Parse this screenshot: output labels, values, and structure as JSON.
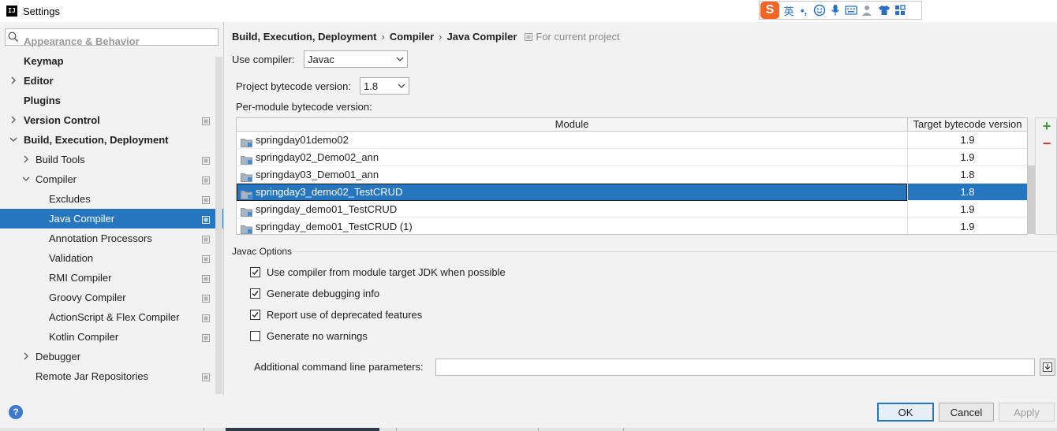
{
  "window": {
    "title": "Settings",
    "app_icon_text": "IJ"
  },
  "ime": {
    "logo": "S",
    "lang": "英",
    "punct": "•,",
    "icons": [
      "smiley-icon",
      "mic-icon",
      "keyboard-icon",
      "user-icon",
      "shirt-icon",
      "grid-icon"
    ]
  },
  "sidebar": {
    "search_placeholder": "",
    "items": [
      {
        "label": "Appearance & Behavior",
        "level": 0,
        "bold": true,
        "arrow": "",
        "faded": true,
        "copy": false
      },
      {
        "label": "Keymap",
        "level": 0,
        "bold": true,
        "arrow": "",
        "copy": false
      },
      {
        "label": "Editor",
        "level": 0,
        "bold": true,
        "arrow": "right",
        "copy": false
      },
      {
        "label": "Plugins",
        "level": 0,
        "bold": true,
        "arrow": "",
        "copy": false
      },
      {
        "label": "Version Control",
        "level": 0,
        "bold": true,
        "arrow": "right",
        "copy": true
      },
      {
        "label": "Build, Execution, Deployment",
        "level": 0,
        "bold": true,
        "arrow": "down",
        "copy": false
      },
      {
        "label": "Build Tools",
        "level": 1,
        "bold": false,
        "arrow": "right",
        "copy": true
      },
      {
        "label": "Compiler",
        "level": 1,
        "bold": false,
        "arrow": "down",
        "copy": true
      },
      {
        "label": "Excludes",
        "level": 2,
        "bold": false,
        "arrow": "",
        "copy": true
      },
      {
        "label": "Java Compiler",
        "level": 2,
        "bold": false,
        "arrow": "",
        "copy": true,
        "selected": true
      },
      {
        "label": "Annotation Processors",
        "level": 2,
        "bold": false,
        "arrow": "",
        "copy": true
      },
      {
        "label": "Validation",
        "level": 2,
        "bold": false,
        "arrow": "",
        "copy": true
      },
      {
        "label": "RMI Compiler",
        "level": 2,
        "bold": false,
        "arrow": "",
        "copy": true
      },
      {
        "label": "Groovy Compiler",
        "level": 2,
        "bold": false,
        "arrow": "",
        "copy": true
      },
      {
        "label": "ActionScript & Flex Compiler",
        "level": 2,
        "bold": false,
        "arrow": "",
        "copy": true
      },
      {
        "label": "Kotlin Compiler",
        "level": 2,
        "bold": false,
        "arrow": "",
        "copy": true
      },
      {
        "label": "Debugger",
        "level": 1,
        "bold": false,
        "arrow": "right",
        "copy": false
      },
      {
        "label": "Remote Jar Repositories",
        "level": 1,
        "bold": false,
        "arrow": "",
        "copy": true
      }
    ]
  },
  "breadcrumb": {
    "crumbs": [
      "Build, Execution, Deployment",
      "Compiler",
      "Java Compiler"
    ],
    "separator": "›",
    "scope": "For current project"
  },
  "compiler": {
    "label": "Use compiler:",
    "value": "Javac"
  },
  "bytecode": {
    "label": "Project bytecode version:",
    "value": "1.8",
    "per_module_label": "Per-module bytecode version:"
  },
  "modules_table": {
    "headers": [
      "Module",
      "Target bytecode version"
    ],
    "rows": [
      {
        "module": "springday01demo02",
        "version": "1.9"
      },
      {
        "module": "springday02_Demo02_ann",
        "version": "1.9"
      },
      {
        "module": "springday03_Demo01_ann",
        "version": "1.8"
      },
      {
        "module": "springday3_demo02_TestCRUD",
        "version": "1.8",
        "selected": true
      },
      {
        "module": "springday_demo01_TestCRUD",
        "version": "1.9"
      },
      {
        "module": "springday_demo01_TestCRUD (1)",
        "version": "1.9"
      }
    ],
    "add_label": "+",
    "remove_label": "−"
  },
  "javac_options": {
    "title": "Javac Options",
    "checks": [
      {
        "label": "Use compiler from module target JDK when possible",
        "checked": true
      },
      {
        "label": "Generate debugging info",
        "checked": true
      },
      {
        "label": "Report use of deprecated features",
        "checked": true
      },
      {
        "label": "Generate no warnings",
        "checked": false
      }
    ],
    "params_label": "Additional command line parameters:",
    "params_value": ""
  },
  "footer": {
    "help": "?",
    "ok": "OK",
    "cancel": "Cancel",
    "apply": "Apply"
  },
  "colors": {
    "accent": "#2675bf",
    "add": "#3c9a3c",
    "remove": "#d0342c"
  }
}
